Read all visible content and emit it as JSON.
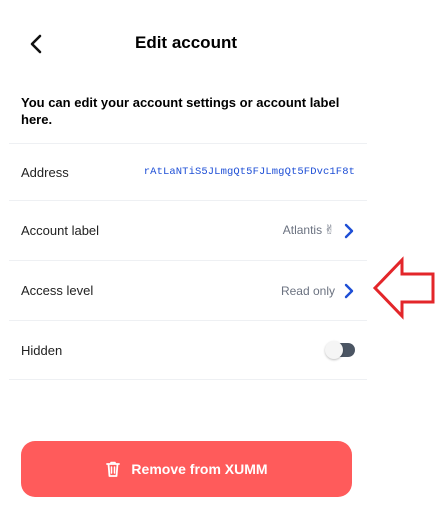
{
  "header": {
    "title": "Edit account"
  },
  "intro": "You can edit your account settings or account label here.",
  "rows": [
    {
      "label": "Address",
      "value": "rAtLaNTiS5JLmgQt5FJLmgQt5FDvc1F8t"
    },
    {
      "label": "Account label",
      "value": "Atlantis",
      "emoji": "✌"
    },
    {
      "label": "Access level",
      "value": "Read only"
    },
    {
      "label": "Hidden",
      "toggle": false
    }
  ],
  "remove_button": {
    "label": "Remove from XUMM"
  },
  "colors": {
    "accent": "#1e4fd6",
    "danger": "#ff5b5b",
    "annotation": "#e3262a"
  },
  "icons": [
    "back-chevron-icon",
    "chevron-right-icon",
    "trash-icon",
    "red-arrow-annotation-icon"
  ]
}
